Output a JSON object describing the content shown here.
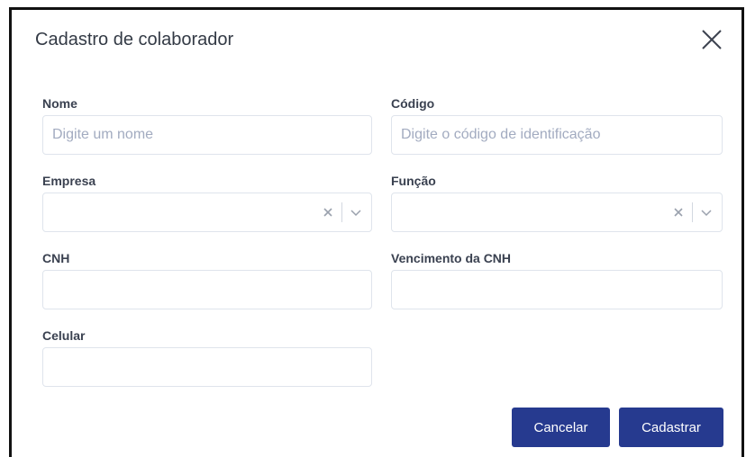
{
  "dialog": {
    "title": "Cadastro de colaborador"
  },
  "fields": {
    "nome": {
      "label": "Nome",
      "placeholder": "Digite um nome",
      "value": ""
    },
    "codigo": {
      "label": "Código",
      "placeholder": "Digite o código de identificação",
      "value": ""
    },
    "empresa": {
      "label": "Empresa",
      "value": ""
    },
    "funcao": {
      "label": "Função",
      "value": ""
    },
    "cnh": {
      "label": "CNH",
      "value": ""
    },
    "vencimento_cnh": {
      "label": "Vencimento da CNH",
      "value": ""
    },
    "celular": {
      "label": "Celular",
      "value": ""
    }
  },
  "actions": {
    "cancel_label": "Cancelar",
    "submit_label": "Cadastrar"
  },
  "colors": {
    "primary_button": "#263a8f",
    "input_border": "#dfe4ec",
    "placeholder": "#a2abc0"
  },
  "icons": [
    "close-icon",
    "clear-icon",
    "chevron-down-icon"
  ]
}
